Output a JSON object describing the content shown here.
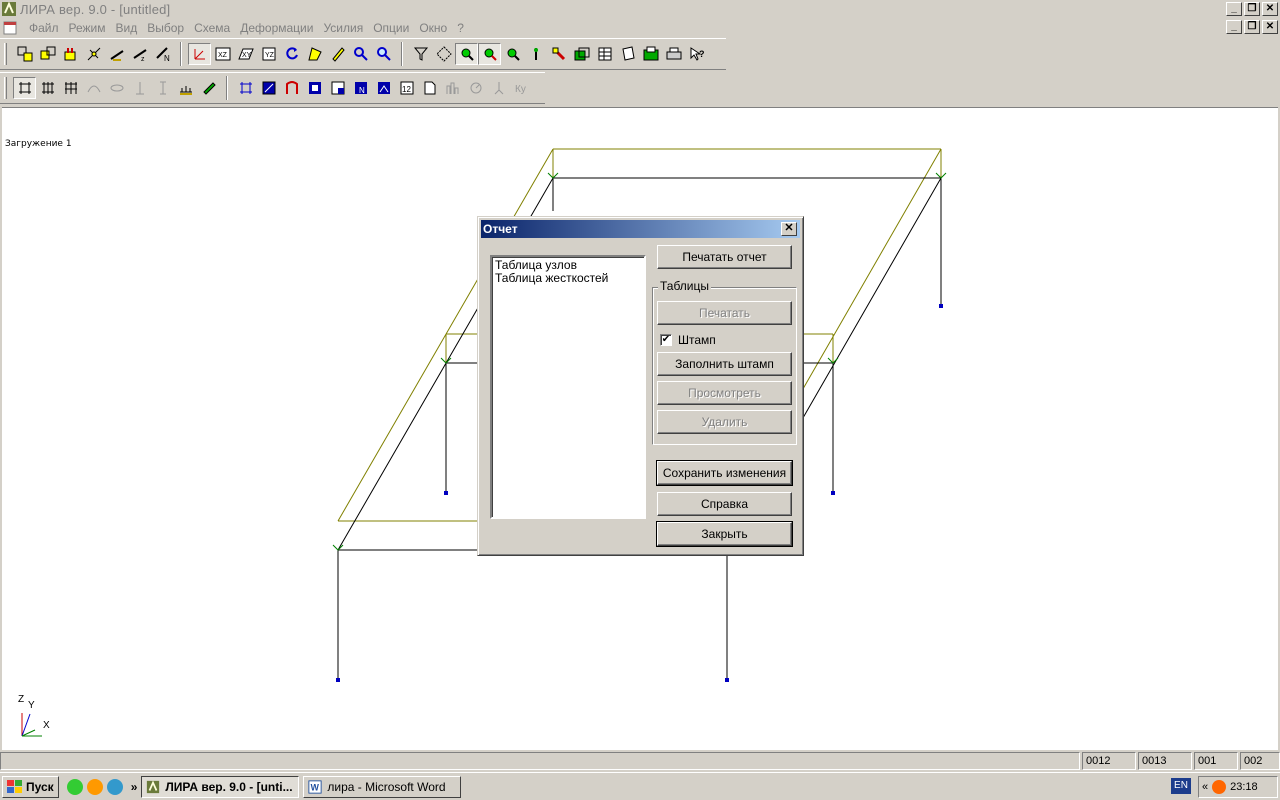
{
  "window": {
    "title": "ЛИРА  вер. 9.0 - [untitled]",
    "minimize_glyph": "_",
    "restore_glyph": "❐",
    "close_glyph": "✕"
  },
  "menu": {
    "items": [
      "Файл",
      "Режим",
      "Вид",
      "Выбор",
      "Схема",
      "Деформации",
      "Усилия",
      "Опции",
      "Окно",
      "?"
    ]
  },
  "canvas": {
    "load_label": "Загружение  1",
    "axes": {
      "z": "Z",
      "y": "Y",
      "x": "X"
    }
  },
  "dialog": {
    "title": "Отчет",
    "close_glyph": "✕",
    "list_items": [
      "Таблица узлов",
      "Таблица жесткостей"
    ],
    "print_report": "Печатать отчет",
    "tables_group": "Таблицы",
    "print": "Печатать",
    "stamp_label": "Штамп",
    "stamp_checked_glyph": "✔",
    "fill_stamp": "Заполнить штамп",
    "view": "Просмотреть",
    "delete": "Удалить",
    "save_changes": "Сохранить изменения",
    "help": "Справка",
    "close": "Закрыть"
  },
  "statusbar": {
    "cells": [
      "0012",
      "0013",
      "001",
      "002"
    ]
  },
  "taskbar": {
    "start": "Пуск",
    "chevron": "»",
    "tasks": [
      "ЛИРА  вер. 9.0 - [unti...",
      "лира - Microsoft Word"
    ],
    "lang": "EN",
    "tray_chevron": "«",
    "clock": "23:18"
  },
  "colors": {
    "frame_lines": "#000000",
    "deformed_lines": "#808000",
    "node_markers": "#0000c0",
    "support_arrows": "#008000",
    "title_gradient_start": "#0a246a",
    "title_gradient_end": "#a6caf0"
  }
}
